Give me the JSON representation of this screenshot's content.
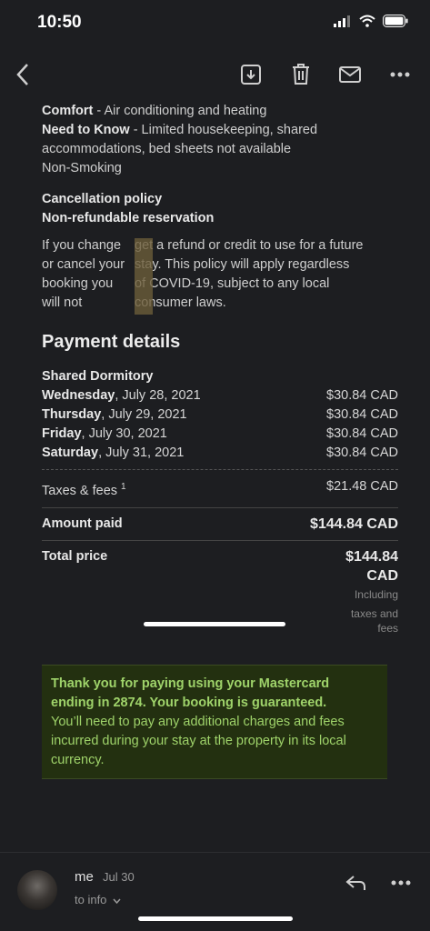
{
  "status": {
    "time": "10:50"
  },
  "lodging": {
    "comfort_label": "Comfort",
    "comfort_text": " - Air conditioning and heating",
    "need_label": "Need to Know",
    "need_text_1": " - Limited housekeeping, shared",
    "need_text_2": "accommodations, bed sheets not available",
    "non_smoking": "Non-Smoking"
  },
  "cancellation": {
    "heading": "Cancellation policy",
    "subheading": "Non-refundable reservation",
    "col1": [
      "If you change",
      "or cancel your",
      "booking you",
      "will not"
    ],
    "col2": [
      "get a refund or credit to use for a future",
      "stay. This policy will apply regardless",
      "of COVID-19, subject to any local",
      "consumer laws."
    ]
  },
  "payment": {
    "heading": "Payment details",
    "room_type": "Shared Dormitory",
    "nights": [
      {
        "day": "Wednesday",
        "date": ", July 28, 2021",
        "price": "$30.84 CAD"
      },
      {
        "day": "Thursday",
        "date": ", July 29, 2021",
        "price": "$30.84 CAD"
      },
      {
        "day": "Friday",
        "date": ", July 30, 2021",
        "price": "$30.84 CAD"
      },
      {
        "day": "Saturday",
        "date": ", July 31, 2021",
        "price": "$30.84 CAD"
      }
    ],
    "taxes_label": "Taxes & fees",
    "taxes_note": "1",
    "taxes_value": "$21.48 CAD",
    "paid_label": "Amount paid",
    "paid_value": "$144.84 CAD",
    "total_label": "Total price",
    "total_value_1": "$144.84",
    "total_value_2": "CAD",
    "including_1": "Including",
    "including_2": "taxes and",
    "including_3": "fees"
  },
  "notice": {
    "line1": "Thank you for paying using your Mastercard",
    "line2": "ending in 2874. Your booking is guaranteed.",
    "line3": "You’ll need to pay any additional charges and fees",
    "line4": "incurred during your stay at the property in its local",
    "line5": "currency."
  },
  "footer": {
    "sender": "me",
    "date": "Jul 30",
    "to": "to info"
  },
  "icons": [
    "back-icon",
    "archive-icon",
    "trash-icon",
    "mail-icon",
    "more-icon",
    "reply-icon",
    "wifi-icon",
    "battery-icon",
    "signal-icon"
  ]
}
